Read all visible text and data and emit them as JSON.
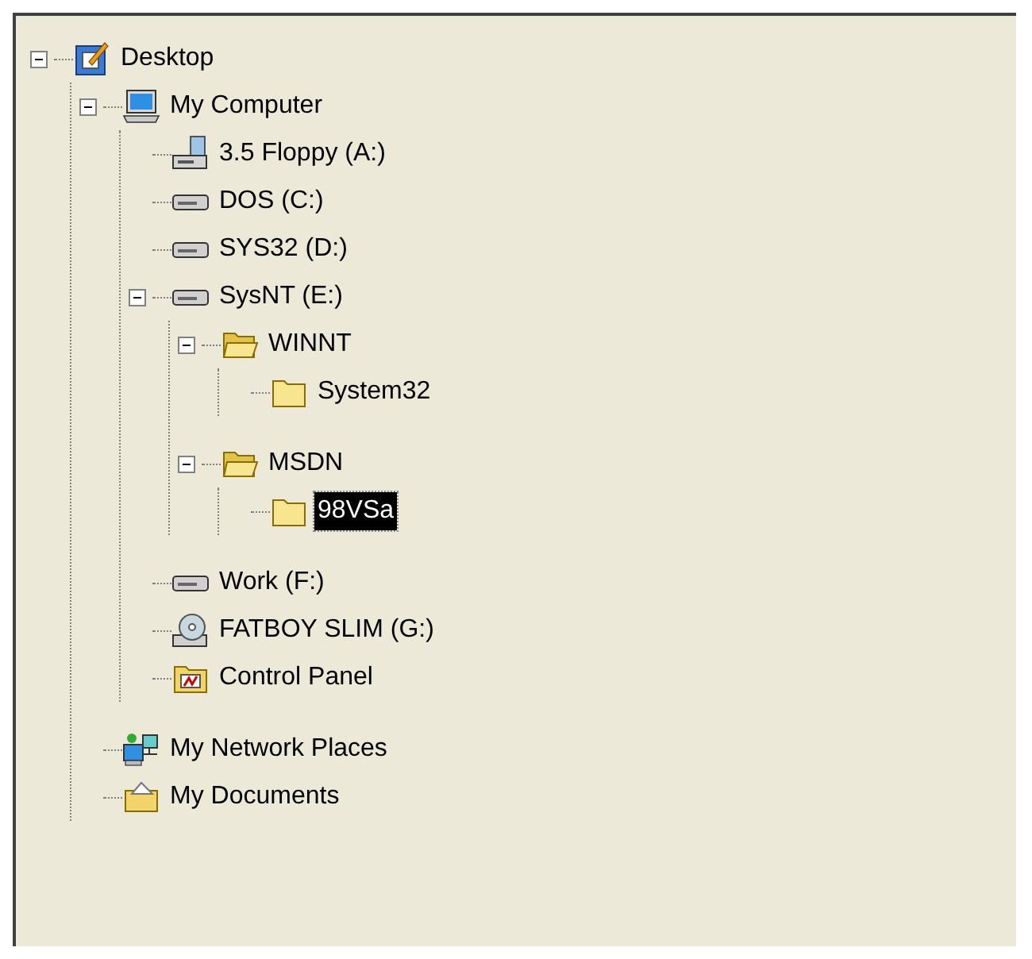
{
  "tree": [
    {
      "label": "Desktop",
      "kind": "desktop",
      "expanded": true,
      "selected": false,
      "children": [
        {
          "label": "My Computer",
          "kind": "computer",
          "expanded": true,
          "selected": false,
          "children": [
            {
              "label": "3.5 Floppy (A:)",
              "kind": "floppy",
              "selected": false
            },
            {
              "label": "DOS (C:)",
              "kind": "drive",
              "selected": false
            },
            {
              "label": "SYS32 (D:)",
              "kind": "drive",
              "selected": false
            },
            {
              "label": "SysNT (E:)",
              "kind": "drive",
              "expanded": true,
              "selected": false,
              "children": [
                {
                  "label": "WINNT",
                  "kind": "open-folder",
                  "expanded": true,
                  "selected": false,
                  "children": [
                    {
                      "label": "System32",
                      "kind": "folder",
                      "selected": false
                    }
                  ]
                },
                {
                  "label": "MSDN",
                  "kind": "open-folder",
                  "expanded": true,
                  "selected": false,
                  "children": [
                    {
                      "label": "98VSa",
                      "kind": "folder",
                      "selected": true
                    }
                  ]
                }
              ]
            },
            {
              "label": "Work (F:)",
              "kind": "drive",
              "selected": false
            },
            {
              "label": "FATBOY SLIM (G:)",
              "kind": "cdrom",
              "selected": false
            },
            {
              "label": "Control Panel",
              "kind": "control-panel",
              "selected": false
            }
          ]
        },
        {
          "label": "My Network Places",
          "kind": "network",
          "selected": false
        },
        {
          "label": "My Documents",
          "kind": "documents",
          "selected": false
        }
      ]
    }
  ]
}
